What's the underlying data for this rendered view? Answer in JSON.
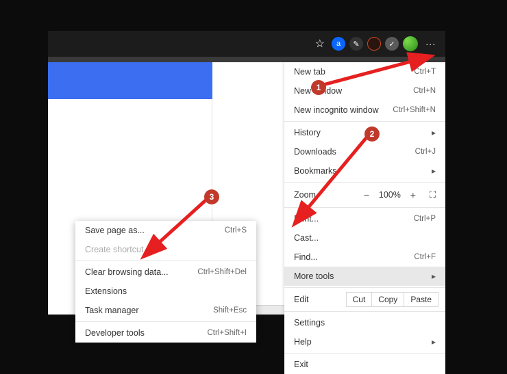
{
  "mainMenu": {
    "newTab": {
      "label": "New tab",
      "shortcut": "Ctrl+T"
    },
    "newWindow": {
      "label": "New window",
      "shortcut": "Ctrl+N"
    },
    "newIncognito": {
      "label": "New incognito window",
      "shortcut": "Ctrl+Shift+N"
    },
    "history": {
      "label": "History"
    },
    "downloads": {
      "label": "Downloads",
      "shortcut": "Ctrl+J"
    },
    "bookmarks": {
      "label": "Bookmarks"
    },
    "zoom": {
      "label": "Zoom",
      "value": "100%",
      "minus": "−",
      "plus": "+"
    },
    "print": {
      "label": "Print...",
      "shortcut": "Ctrl+P"
    },
    "cast": {
      "label": "Cast..."
    },
    "find": {
      "label": "Find...",
      "shortcut": "Ctrl+F"
    },
    "moreTools": {
      "label": "More tools"
    },
    "edit": {
      "label": "Edit",
      "cut": "Cut",
      "copy": "Copy",
      "paste": "Paste"
    },
    "settings": {
      "label": "Settings"
    },
    "help": {
      "label": "Help"
    },
    "exit": {
      "label": "Exit"
    }
  },
  "subMenu": {
    "savePage": {
      "label": "Save page as...",
      "shortcut": "Ctrl+S"
    },
    "createShortcut": {
      "label": "Create shortcut..."
    },
    "clearBrowsing": {
      "label": "Clear browsing data...",
      "shortcut": "Ctrl+Shift+Del"
    },
    "extensions": {
      "label": "Extensions"
    },
    "taskManager": {
      "label": "Task manager",
      "shortcut": "Shift+Esc"
    },
    "devTools": {
      "label": "Developer tools",
      "shortcut": "Ctrl+Shift+I"
    }
  },
  "badges": {
    "one": "1",
    "two": "2",
    "three": "3"
  },
  "toolbar": {
    "extA": "a"
  }
}
